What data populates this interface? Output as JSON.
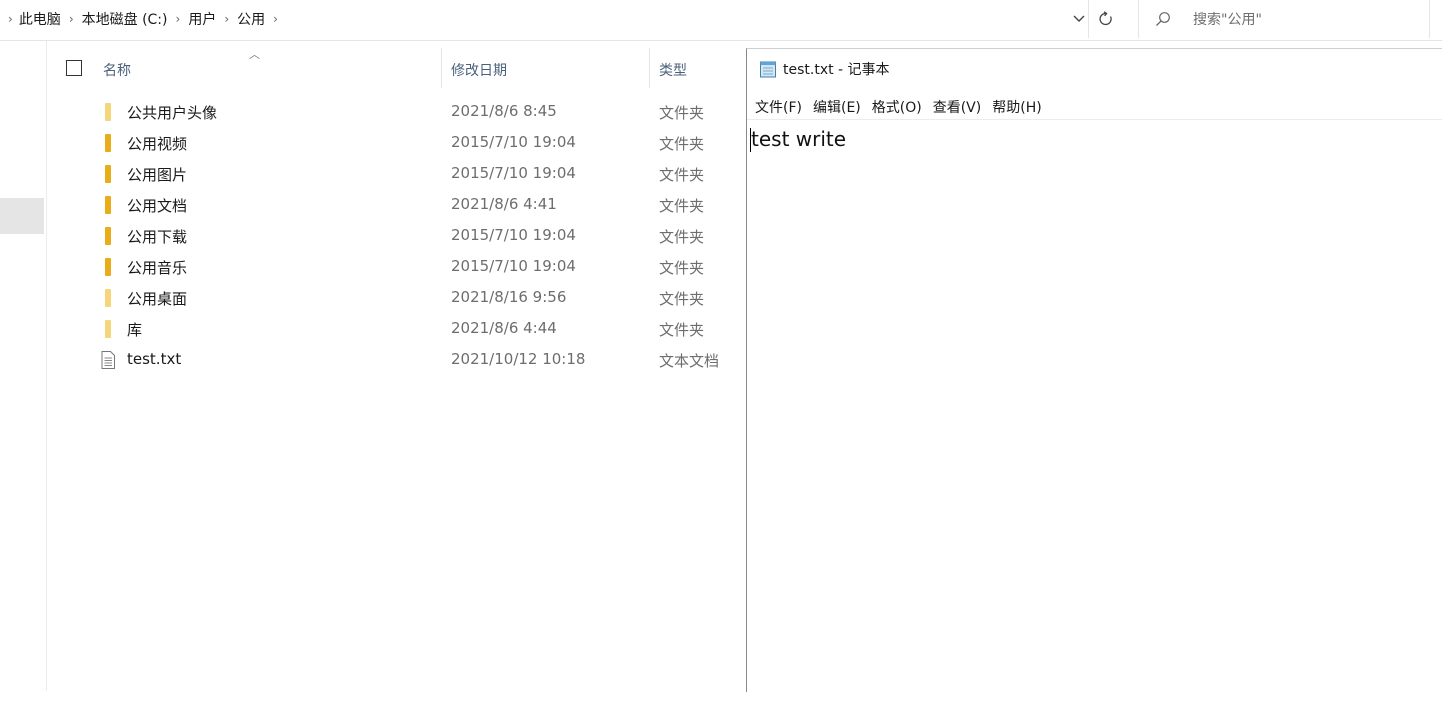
{
  "breadcrumb": {
    "items": [
      "此电脑",
      "本地磁盘 (C:)",
      "用户",
      "公用"
    ],
    "separator": "›"
  },
  "search": {
    "placeholder": "搜索\"公用\""
  },
  "columns": {
    "name": "名称",
    "date": "修改日期",
    "type": "类型"
  },
  "files": [
    {
      "name": "公共用户头像",
      "date": "2021/8/6 8:45",
      "type": "文件夹",
      "kind": "folder-light"
    },
    {
      "name": "公用视频",
      "date": "2015/7/10 19:04",
      "type": "文件夹",
      "kind": "folder"
    },
    {
      "name": "公用图片",
      "date": "2015/7/10 19:04",
      "type": "文件夹",
      "kind": "folder"
    },
    {
      "name": "公用文档",
      "date": "2021/8/6 4:41",
      "type": "文件夹",
      "kind": "folder"
    },
    {
      "name": "公用下载",
      "date": "2015/7/10 19:04",
      "type": "文件夹",
      "kind": "folder"
    },
    {
      "name": "公用音乐",
      "date": "2015/7/10 19:04",
      "type": "文件夹",
      "kind": "folder"
    },
    {
      "name": "公用桌面",
      "date": "2021/8/16 9:56",
      "type": "文件夹",
      "kind": "folder-light"
    },
    {
      "name": "库",
      "date": "2021/8/6 4:44",
      "type": "文件夹",
      "kind": "folder-light"
    },
    {
      "name": "test.txt",
      "date": "2021/10/12 10:18",
      "type": "文本文档",
      "kind": "text-file"
    }
  ],
  "notepad": {
    "title": "test.txt - 记事本",
    "menu": [
      "文件(F)",
      "编辑(E)",
      "格式(O)",
      "查看(V)",
      "帮助(H)"
    ],
    "content": "test write"
  },
  "colors": {
    "folder": "#e9ad19",
    "folder_light": "#f5d67a",
    "header_text": "#4c607a",
    "secondary_text": "#6d6d6d"
  }
}
